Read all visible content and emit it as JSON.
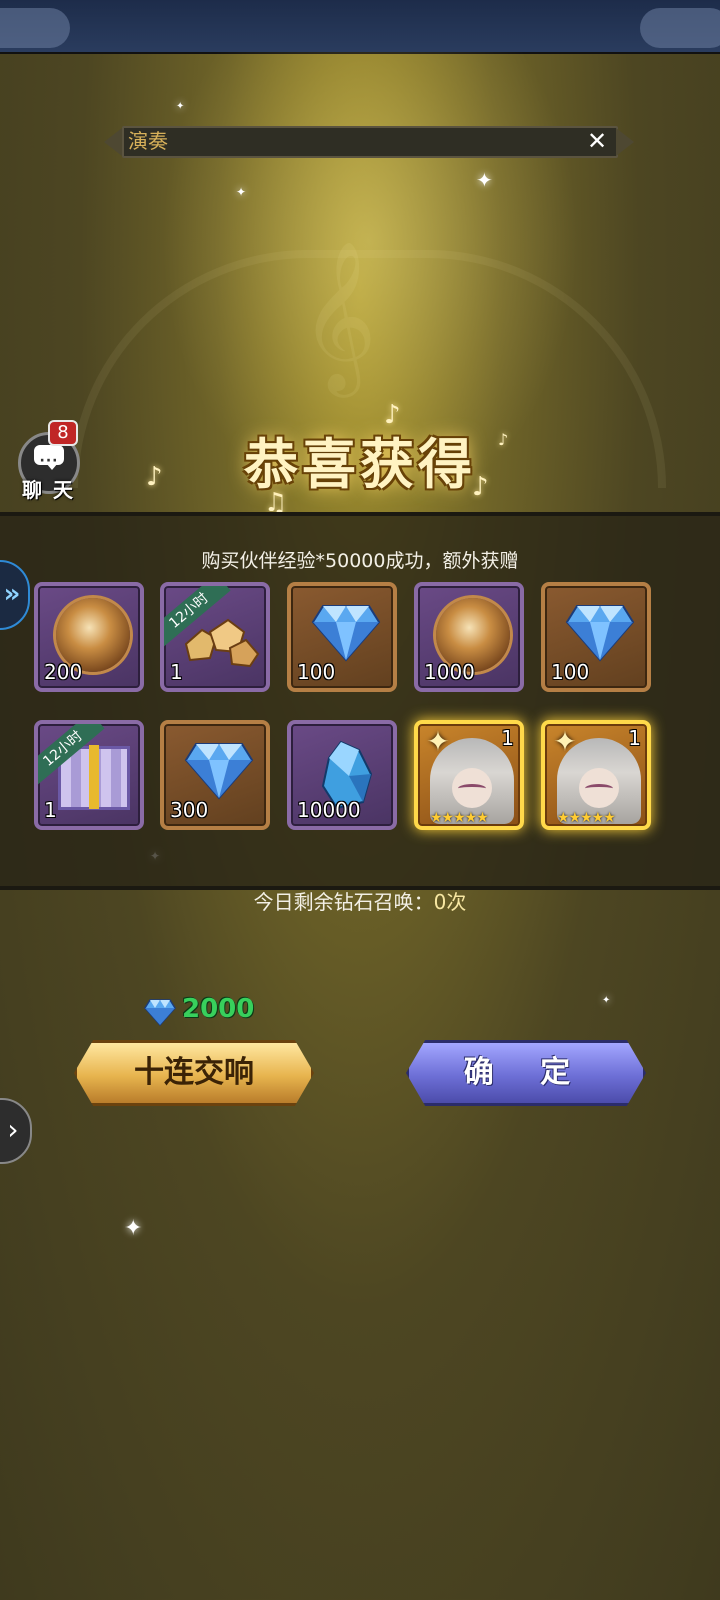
{
  "marquee": {
    "text": "演奏",
    "close_icon": "close-icon"
  },
  "chat": {
    "label": "聊 天",
    "badge_count": "8"
  },
  "title": "恭喜获得",
  "reward_message": "购买伙伴经验*50000成功，额外获赠",
  "rewards": [
    {
      "kind": "exp-orb",
      "qty": "200",
      "frame": "purple",
      "tag": ""
    },
    {
      "kind": "gold-rocks",
      "qty": "1",
      "frame": "purple",
      "tag": "12小时"
    },
    {
      "kind": "diamond",
      "qty": "100",
      "frame": "brown",
      "tag": ""
    },
    {
      "kind": "exp-orb",
      "qty": "1000",
      "frame": "purple",
      "tag": ""
    },
    {
      "kind": "diamond",
      "qty": "100",
      "frame": "brown",
      "tag": ""
    },
    {
      "kind": "exp-gift",
      "qty": "1",
      "frame": "purple",
      "tag": "12小时"
    },
    {
      "kind": "diamond",
      "qty": "300",
      "frame": "brown",
      "tag": ""
    },
    {
      "kind": "crystal",
      "qty": "10000",
      "frame": "purple",
      "tag": ""
    },
    {
      "kind": "hero-portrait",
      "qty": "1",
      "frame": "gold",
      "tag": ""
    },
    {
      "kind": "hero-portrait",
      "qty": "1",
      "frame": "gold",
      "tag": ""
    }
  ],
  "summon": {
    "remaining_label": "今日剩余钻石召唤：",
    "remaining_count": "0次",
    "cost": "2000",
    "cost_icon": "diamond-icon",
    "ten_pull_label": "十连交响",
    "confirm_label": "确 定"
  },
  "colors": {
    "background": "#4d4622",
    "gold_button": "#e7b44e",
    "blue_button": "#6d6fd6",
    "cost_text": "#38d05c",
    "chat_badge": "#c02626"
  }
}
